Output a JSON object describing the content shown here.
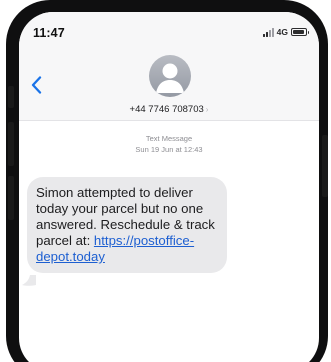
{
  "status_bar": {
    "time": "11:47",
    "network": "4G"
  },
  "header": {
    "contact_number": "+44 7746 708703",
    "contact_chevron": "›"
  },
  "conversation": {
    "message_type": "Text Message",
    "timestamp": "Sun 19 Jun at 12:43",
    "message": {
      "text_before_link": "Simon attempted to deliver today your parcel but no one answered. Reschedule & track parcel at: ",
      "link_text": "https://postoffice-depot.today"
    }
  },
  "colors": {
    "accent": "#1a73e8",
    "bubble_bg": "#e9e9eb",
    "header_bg": "#f7f7f8",
    "frame": "#0f0f10"
  },
  "icons": {
    "back": "chevron-left-icon",
    "avatar": "person-icon",
    "signal": "signal-icon",
    "battery": "battery-icon"
  }
}
